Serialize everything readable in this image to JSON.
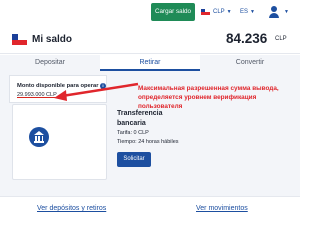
{
  "header": {
    "load_balance_label": "Cargar saldo",
    "currency_code": "CLP",
    "language_code": "ES"
  },
  "balance": {
    "title": "Mi saldo",
    "amount": "84.236",
    "currency": "CLP"
  },
  "tabs": [
    {
      "label": "Depositar",
      "active": false
    },
    {
      "label": "Retirar",
      "active": true
    },
    {
      "label": "Convertir",
      "active": false
    }
  ],
  "withdraw": {
    "available_label": "Monto disponible para operar",
    "available_value": "29.993.000 CLP",
    "annotation": "Максимальная разрешенная сумма вывода, определяется уровнем верификация пользователя",
    "method": {
      "title": "Transferencia bancaria",
      "fee": "Tarifa: 0 CLP",
      "time": "Tiempo: 24 horas hábiles",
      "button_label": "Solicitar"
    }
  },
  "footer": {
    "left_link": "Ver depósitos y retiros",
    "right_link": "Ver movimientos"
  },
  "colors": {
    "accent": "#1d4fa0",
    "green_button": "#1f8b57",
    "annotation_red": "#e0262c"
  }
}
